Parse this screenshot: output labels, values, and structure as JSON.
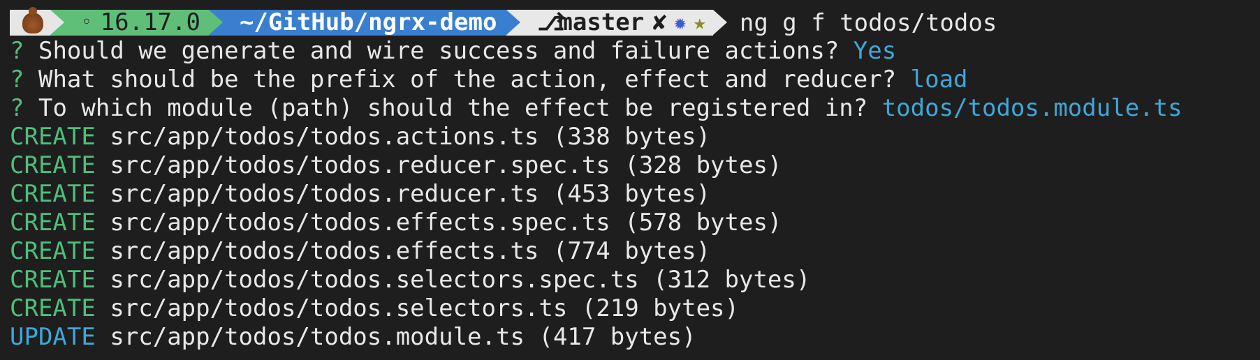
{
  "colors": {
    "background": "#1e1e1e",
    "text": "#e8e8e8",
    "green": "#4fbf7a",
    "blue": "#3fa8d8",
    "seg_node": "#5fbf79",
    "seg_path": "#3a7fcf",
    "seg_git": "#e8e8e8"
  },
  "prompt": {
    "emoji_icon": "poop-icon",
    "node_icon": "dot-icon",
    "node_dot": "◦",
    "node_version": "16.17.0",
    "path": "~/GitHub/ngrx-demo",
    "branch_icon": "git-branch-icon",
    "branch_glyph": "⎇",
    "branch": "master",
    "dirty_glyph": "✘",
    "untracked_glyph": "✹",
    "stash_glyph": "★",
    "command": "ng g f todos/todos"
  },
  "questions": [
    {
      "mark": "?",
      "text": "Should we generate and wire success and failure actions?",
      "answer": "Yes"
    },
    {
      "mark": "?",
      "text": "What should be the prefix of the action, effect and reducer?",
      "answer": "load"
    },
    {
      "mark": "?",
      "text": "To which module (path) should the effect be registered in?",
      "answer": "todos/todos.module.ts"
    }
  ],
  "outputs": [
    {
      "action": "CREATE",
      "file": "src/app/todos/todos.actions.ts (338 bytes)"
    },
    {
      "action": "CREATE",
      "file": "src/app/todos/todos.reducer.spec.ts (328 bytes)"
    },
    {
      "action": "CREATE",
      "file": "src/app/todos/todos.reducer.ts (453 bytes)"
    },
    {
      "action": "CREATE",
      "file": "src/app/todos/todos.effects.spec.ts (578 bytes)"
    },
    {
      "action": "CREATE",
      "file": "src/app/todos/todos.effects.ts (774 bytes)"
    },
    {
      "action": "CREATE",
      "file": "src/app/todos/todos.selectors.spec.ts (312 bytes)"
    },
    {
      "action": "CREATE",
      "file": "src/app/todos/todos.selectors.ts (219 bytes)"
    },
    {
      "action": "UPDATE",
      "file": "src/app/todos/todos.module.ts (417 bytes)"
    }
  ]
}
